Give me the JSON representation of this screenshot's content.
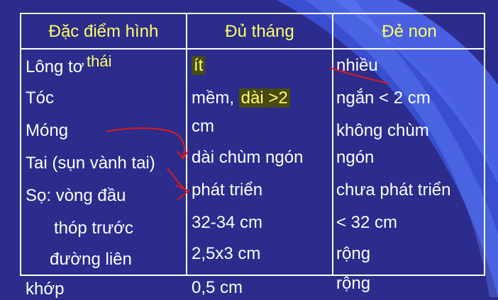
{
  "colors": {
    "background": "#2b2c8c",
    "header_text": "#ffff66",
    "body_text": "#ffffff",
    "highlight_bg": "#4a4a14",
    "annotation_red": "#dd1c1c"
  },
  "table": {
    "headers": [
      "Đặc điểm hình",
      "Đủ tháng",
      "Đẻ non"
    ],
    "header_overflow": "thái",
    "col1": [
      "Lông tơ",
      "Tóc",
      "Móng",
      "Tai (sụn vành tai)",
      "Sọ: vòng đầu",
      "thóp trước",
      "đường liên",
      "khớp"
    ],
    "col2": {
      "long_to": "ít",
      "toc_a": "mềm, ",
      "toc_b": "dài >2",
      "toc_c": "cm",
      "mong": "dài chùm ngón",
      "tai": "phát triển",
      "vong_dau": "32-34 cm",
      "thop_truoc": "2,5x3 cm",
      "duong_lien": "0,5 cm"
    },
    "col3": {
      "long_to": "nhiều",
      "toc": "ngắn < 2 cm",
      "mong_a": "không chùm",
      "mong_b": "ngón",
      "tai": "chưa phát triển",
      "vong_dau": "< 32 cm",
      "thop_truoc": "rộng",
      "duong_lien": "rộng"
    }
  }
}
